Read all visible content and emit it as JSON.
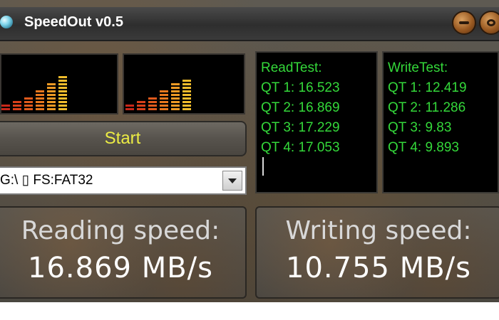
{
  "window": {
    "title": "SpeedOut v0.5"
  },
  "start_button": {
    "label": "Start"
  },
  "drive_select": {
    "value": "G:\\ ▯ FS:FAT32"
  },
  "read_panel": {
    "heading": "ReadTest:",
    "results": [
      "QT 1: 16.523",
      "QT 2: 16.869",
      "QT 3: 17.229",
      "QT 4: 17.053"
    ]
  },
  "write_panel": {
    "heading": "WriteTest:",
    "results": [
      "QT 1: 12.419",
      "QT 2: 11.286",
      "QT 3: 9.83",
      "QT 4: 9.893"
    ]
  },
  "reading": {
    "label": "Reading speed:",
    "value": "16.869 MB/s"
  },
  "writing": {
    "label": "Writing speed:",
    "value": "10.755 MB/s"
  },
  "colors": {
    "panel_text": "#34d83a",
    "start_text": "#ecec44",
    "bar_low": "#d83a1a",
    "bar_high": "#e8e43a"
  },
  "icons": {
    "app": "app-orb-icon",
    "minimize": "minimize-icon",
    "close": "close-icon"
  }
}
